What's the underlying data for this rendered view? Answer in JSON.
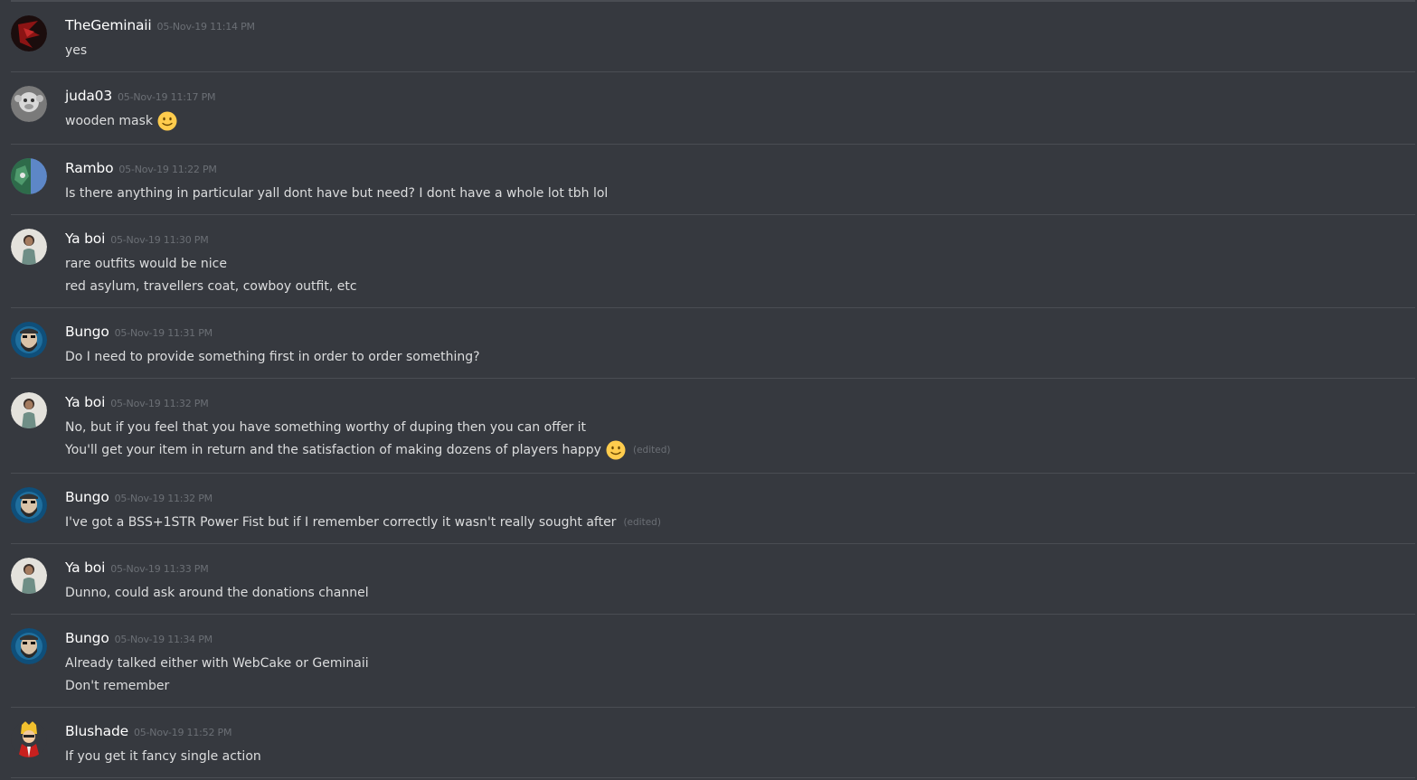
{
  "messages": [
    {
      "username": "TheGeminaii",
      "timestamp": "05-Nov-19 11:14 PM",
      "avatar_icon": "red-dark-avatar-icon",
      "lines": [
        {
          "text": "yes"
        }
      ]
    },
    {
      "username": "juda03",
      "timestamp": "05-Nov-19 11:17 PM",
      "avatar_icon": "grey-monkey-avatar-icon",
      "lines": [
        {
          "text": "wooden mask",
          "emoji": "slight-smile-emoji"
        }
      ]
    },
    {
      "username": "Rambo",
      "timestamp": "05-Nov-19 11:22 PM",
      "avatar_icon": "green-blue-avatar-icon",
      "lines": [
        {
          "text": "Is there anything in particular yall dont have but need? I dont have a whole lot tbh lol"
        }
      ]
    },
    {
      "username": "Ya boi",
      "timestamp": "05-Nov-19 11:30 PM",
      "avatar_icon": "person-photo-avatar-icon",
      "lines": [
        {
          "text": "rare outfits would be nice"
        },
        {
          "text": "red asylum, travellers coat, cowboy outfit, etc"
        }
      ]
    },
    {
      "username": "Bungo",
      "timestamp": "05-Nov-19 11:31 PM",
      "avatar_icon": "blue-bearded-avatar-icon",
      "lines": [
        {
          "text": "Do I need to provide something first in order to order something?"
        }
      ]
    },
    {
      "username": "Ya boi",
      "timestamp": "05-Nov-19 11:32 PM",
      "avatar_icon": "person-photo-avatar-icon",
      "lines": [
        {
          "text": "No, but if you feel that you have something worthy of duping then you can offer it"
        },
        {
          "text": "You'll get your item in return and the satisfaction of making dozens of players happy",
          "emoji": "slight-smile-emoji",
          "edited": "(edited)"
        }
      ]
    },
    {
      "username": "Bungo",
      "timestamp": "05-Nov-19 11:32 PM",
      "avatar_icon": "blue-bearded-avatar-icon",
      "lines": [
        {
          "text": "I've got a BSS+1STR Power Fist but if I remember correctly it wasn't really sought after",
          "edited": "(edited)"
        }
      ]
    },
    {
      "username": "Ya boi",
      "timestamp": "05-Nov-19 11:33 PM",
      "avatar_icon": "person-photo-avatar-icon",
      "lines": [
        {
          "text": "Dunno, could ask around the donations channel"
        }
      ]
    },
    {
      "username": "Bungo",
      "timestamp": "05-Nov-19 11:34 PM",
      "avatar_icon": "blue-bearded-avatar-icon",
      "lines": [
        {
          "text": "Already talked either with WebCake or Geminaii"
        },
        {
          "text": "Don't remember"
        }
      ]
    },
    {
      "username": "Blushade",
      "timestamp": "05-Nov-19 11:52 PM",
      "avatar_icon": "yellow-hair-character-avatar-icon",
      "lines": [
        {
          "text": "If you get it fancy single action"
        }
      ]
    }
  ],
  "colors": {
    "background": "#36393f",
    "divider": "#4a4d53",
    "username": "#ffffff",
    "text": "#dcddde",
    "timestamp": "#6b6f75"
  }
}
